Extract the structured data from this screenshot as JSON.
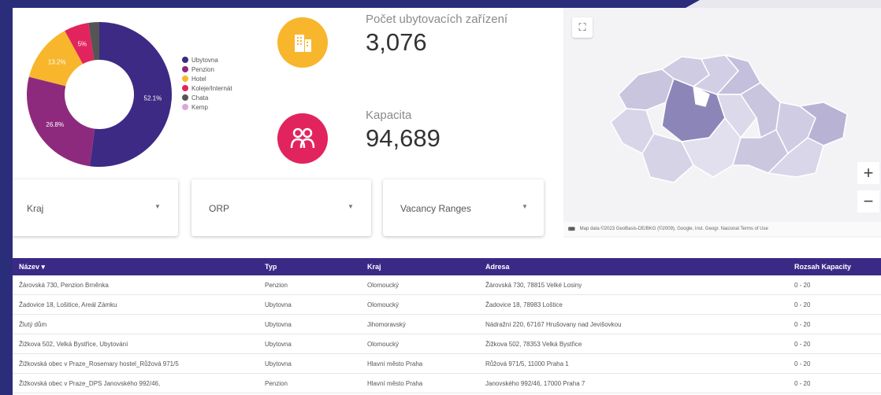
{
  "donut": {
    "segments": [
      {
        "name": "Ubytovna",
        "percent": 52.1,
        "color": "#3d2a84",
        "label": "52.1%"
      },
      {
        "name": "Penzion",
        "percent": 26.8,
        "color": "#8e2a7e",
        "label": "26.8%"
      },
      {
        "name": "Hotel",
        "percent": 13.2,
        "color": "#f8b62c",
        "label": "13.2%"
      },
      {
        "name": "Koleje/Internát",
        "percent": 5.5,
        "color": "#e2245e",
        "label": "5%"
      },
      {
        "name": "Chata",
        "percent": 2.4,
        "color": "#555555",
        "label": ""
      },
      {
        "name": "Kemp",
        "percent": 0.0,
        "color": "#d9a8d9",
        "label": ""
      }
    ]
  },
  "kpi": {
    "facilities_label": "Počet ubytovacích zařízení",
    "facilities_value": "3,076",
    "capacity_label": "Kapacita",
    "capacity_value": "94,689"
  },
  "map": {
    "footer": "Map data ©2023 GeoBasis-DE/BKG (©2009), Google, Inst. Geogr. Nacional   Terms of Use",
    "zoom_in": "+",
    "zoom_out": "−"
  },
  "filters": {
    "kraj": "Kraj",
    "orp": "ORP",
    "vacancy": "Vacancy Ranges"
  },
  "table": {
    "headers": [
      "Název ▾",
      "Typ",
      "Kraj",
      "Adresa",
      "Rozsah Kapacity"
    ],
    "rows": [
      [
        "Žárovská 730, Penzion Brněnka",
        "Penzion",
        "Olomoucký",
        "Žárovská 730, 78815 Velké Losiny",
        "0 - 20"
      ],
      [
        "Žadovice 18, Lošitice, Areál Zámku",
        "Ubytovna",
        "Olomoucký",
        "Žadovice 18, 78983 Loštice",
        "0 - 20"
      ],
      [
        "Žlutý dům",
        "Ubytovna",
        "Jihomoravský",
        "Nádražní 220, 67167 Hrušovany nad Jevišovkou",
        "0 - 20"
      ],
      [
        "Žižkova 502, Velká Bystřice, Ubytování",
        "Ubytovna",
        "Olomoucký",
        "Žižkova 502, 78353 Velká Bystřice",
        "0 - 20"
      ],
      [
        "Žižkovská obec v Praze_Rosemary hostel_Růžová 971/5",
        "Ubytovna",
        "Hlavní město Praha",
        "Růžová 971/5, 11000 Praha 1",
        "0 - 20"
      ],
      [
        "Žižkovská obec v Praze_DPS Janovského 992/46,",
        "Penzion",
        "Hlavní město Praha",
        "Janovského 992/46, 17000 Praha 7",
        "0 - 20"
      ]
    ]
  }
}
